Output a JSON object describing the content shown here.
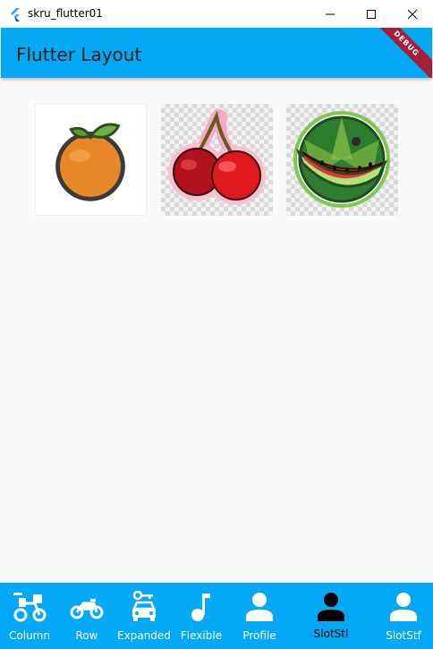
{
  "window": {
    "title": "skru_flutter01"
  },
  "appbar": {
    "title": "Flutter Layout",
    "debug_banner": "DEBUG"
  },
  "tiles": [
    {
      "name": "orange",
      "icon": "orange-fruit-icon"
    },
    {
      "name": "cherry",
      "icon": "cherry-fruit-icon"
    },
    {
      "name": "watermelon",
      "icon": "watermelon-fruit-icon"
    }
  ],
  "bottom_nav": {
    "selected_index": 5,
    "items": [
      {
        "label": "Column",
        "icon": "bike-delivery-icon"
      },
      {
        "label": "Row",
        "icon": "motorcycle-icon"
      },
      {
        "label": "Expanded",
        "icon": "car-key-icon"
      },
      {
        "label": "Flexible",
        "icon": "music-note-icon"
      },
      {
        "label": "Profile",
        "icon": "person-icon"
      },
      {
        "label": "SlotStl",
        "icon": "person-icon"
      },
      {
        "label": "SlotStf",
        "icon": "person-icon"
      }
    ]
  },
  "colors": {
    "primary": "#03a9f4",
    "debug": "#a51f36",
    "selected": "#000000",
    "unselected": "#ffffff"
  }
}
